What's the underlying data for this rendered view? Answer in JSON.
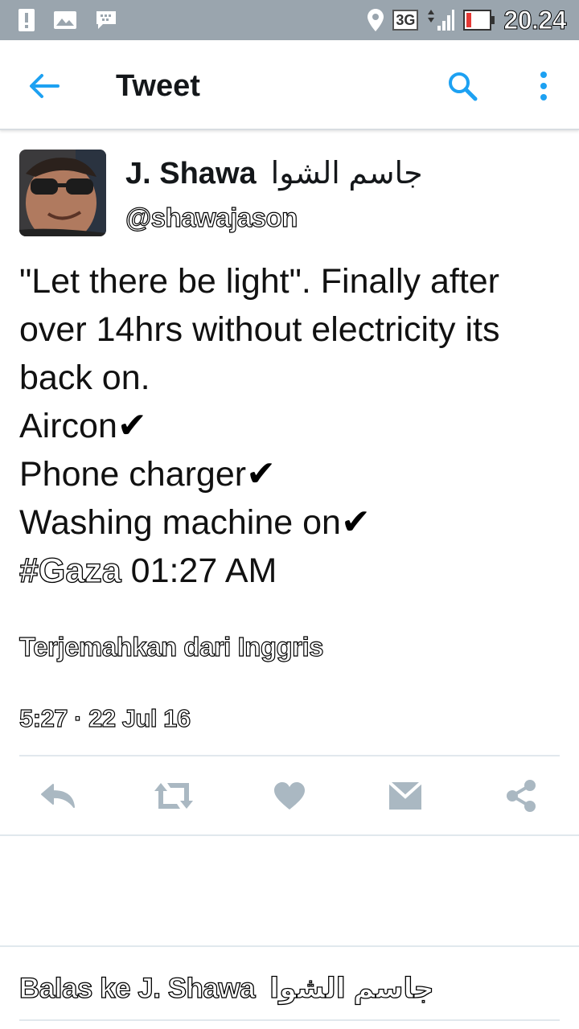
{
  "status_bar": {
    "time": "20.24",
    "network": "3G",
    "icons": [
      "alert-icon",
      "gallery-icon",
      "bbm-icon",
      "location-icon",
      "signal-icon",
      "battery-icon"
    ]
  },
  "app_bar": {
    "title": "Tweet",
    "icons": [
      "back-arrow-icon",
      "search-icon",
      "more-vertical-icon"
    ]
  },
  "tweet": {
    "author_name": "J. Shawa",
    "author_name_arabic": "جاسم الشوا",
    "handle": "@shawajason",
    "lines": [
      "\"Let there be light\". Finally after",
      "over 14hrs without electricity its",
      "back on."
    ],
    "items": [
      "Aircon",
      "Phone charger",
      "Washing machine on"
    ],
    "check_mark": "✔",
    "hashtag": "#Gaza",
    "time_text": "01:27 AM",
    "translate_link": "Terjemahkan dari Inggris",
    "timestamp": "5:27 · 22 Jul 16"
  },
  "actions": [
    "reply-icon",
    "retweet-icon",
    "like-icon",
    "direct-message-icon",
    "share-icon"
  ],
  "reply": {
    "label": "Balas ke J. Shawa",
    "arabic": "جاسم الشوا"
  },
  "colors": {
    "status_bar": "#9aa5ae",
    "accent": "#1da1f2",
    "action_icon": "#aab8c2",
    "divider": "#e1e8ed"
  }
}
